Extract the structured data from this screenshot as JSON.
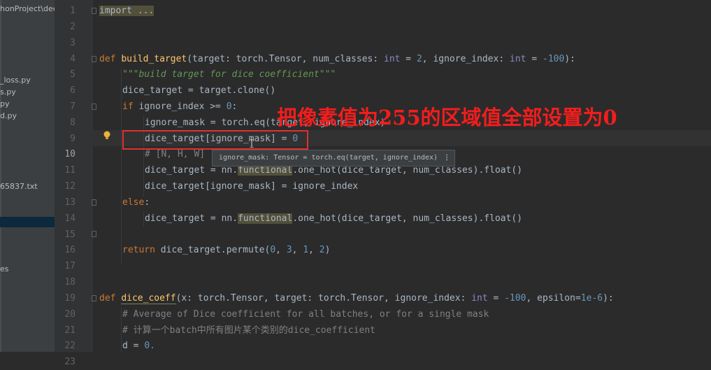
{
  "project": {
    "root": "honProject\\dee",
    "items": [
      "_loss.py",
      "s.py",
      "py",
      "d.py",
      "65837.txt",
      "es"
    ]
  },
  "gutter": {
    "line_numbers": [
      "1",
      "2",
      "3",
      "4",
      "5",
      "6",
      "7",
      "8",
      "9",
      "10",
      "11",
      "12",
      "13",
      "14",
      "15",
      "16",
      "17",
      "18",
      "19",
      "20",
      "21",
      "22",
      "23"
    ],
    "current_line": "10"
  },
  "code": {
    "l1": "import ...",
    "l5_kw": "def ",
    "l5_fn": "build_target",
    "l5_a": "(target: torch.Tensor, num_classes: ",
    "l5_int1": "int",
    "l5_b": " = ",
    "l5_n1": "2",
    "l5_c": ", ignore_index: ",
    "l5_int2": "int",
    "l5_d": " = ",
    "l5_n2": "-100",
    "l5_e": "):",
    "l6": "\"\"\"build target for dice coefficient\"\"\"",
    "l7": "dice_target = target.clone()",
    "l8_kw": "if ",
    "l8_a": "ignore_index >= ",
    "l8_n": "0",
    "l8_b": ":",
    "l9": "ignore_mask = torch.eq(target, ignore_index)",
    "l10_a": "dice_target",
    "l10_b": "[ignore_mask] = ",
    "l10_n": "0",
    "l11": "# [N, H, W] -> [N, H, W, C]",
    "l12_a": "dice_target",
    "l12_b": " = nn.",
    "l12_c": "functional",
    "l12_d": ".one_hot(",
    "l12_e": "dice_target",
    "l12_f": ", num_classes).float()",
    "l13_a": "dice_target",
    "l13_b": "[ignore_mask] = ignore_index",
    "l14_kw": "else",
    "l14_b": ":",
    "l15_a": "dice_target",
    "l15_b": " = nn.",
    "l15_c": "functional",
    "l15_d": ".one_hot(",
    "l15_e": "dice_target",
    "l15_f": ", num_classes).float()",
    "l17_kw": "return ",
    "l17_a": "dice_target",
    "l17_b": ".permute(",
    "l17_n1": "0",
    "l17_c": ", ",
    "l17_n2": "3",
    "l17_d": ", ",
    "l17_n3": "1",
    "l17_e": ", ",
    "l17_n4": "2",
    "l17_f": ")",
    "l20_kw": "def ",
    "l20_fn": "dice_coeff",
    "l20_a": "(x: torch.Tensor, target: torch.Tensor, ignore_index: ",
    "l20_int": "int",
    "l20_b": " = ",
    "l20_n": "-100",
    "l20_c": ", epsilon=",
    "l20_eps": "1e-6",
    "l20_d": "):",
    "l21": "# Average of Dice coefficient for all batches, or for a single mask",
    "l22": "# 计算一个batch中所有图片某个类别的dice_coefficient",
    "l23_a": "d = ",
    "l23_n": "0."
  },
  "tooltip": {
    "text": "ignore_mask: Tensor = torch.eq(target, ignore_index)",
    "more_icon": "⋮"
  },
  "annotation": "把像素值为255的区域值全部设置为0",
  "colors": {
    "background": "#2b2b2b",
    "keyword": "#cc7832",
    "function": "#ffc66d",
    "number": "#6897bb",
    "docstring": "#629755",
    "comment": "#808080",
    "annotation": "#f21d1d",
    "highlight_box": "#e03030"
  }
}
